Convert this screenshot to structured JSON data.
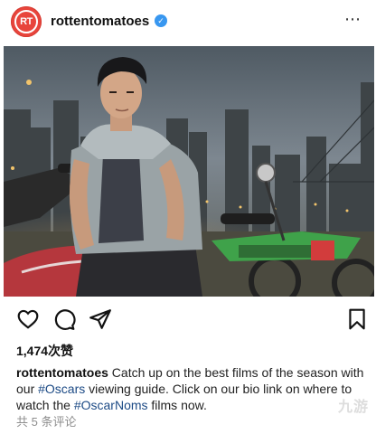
{
  "account": {
    "username": "rottentomatoes",
    "avatar_text": "RT",
    "verified": true,
    "brand_color": "#e8453c",
    "verified_color": "#3897f0"
  },
  "header": {
    "more_icon": "⋯"
  },
  "post": {
    "image_alt": "Young man in sleeveless hoodie sitting on a motorcycle with a city skyline at dusk",
    "likes": "1,474次赞",
    "caption": {
      "user": "rottentomatoes",
      "text_1": " Catch up on the best films of the season with our ",
      "tag_1": "#Oscars",
      "text_2": " viewing guide. Click on our bio link on where to watch the ",
      "tag_2": "#OscarNoms",
      "text_3": " films now."
    },
    "comments_link": "共 5 条评论"
  },
  "actions": {
    "icons": [
      "heart-icon",
      "comment-icon",
      "share-icon",
      "bookmark-icon"
    ]
  },
  "watermark": "九游"
}
